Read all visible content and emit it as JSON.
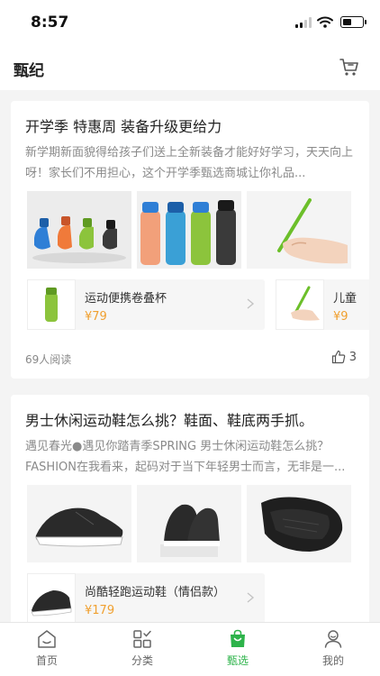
{
  "status_bar": {
    "time": "8:57"
  },
  "header": {
    "title": "甄纪",
    "cart_icon": "cart-icon"
  },
  "articles": [
    {
      "title": "开学季 特惠周 装备升级更给力",
      "summary": "新学期新面貌得给孩子们送上全新装备才能好好学习，天天向上呀！家长们不用担心，这个开学季甄选商城让你礼品...",
      "images": [
        "folding-bottles-image",
        "colored-bottles-image",
        "green-pencil-image"
      ],
      "products": [
        {
          "name": "运动便携卷叠杯",
          "price": "¥79"
        },
        {
          "name": "儿童",
          "price": "¥9"
        }
      ],
      "read_count": "69人阅读",
      "likes": "3"
    },
    {
      "title": "男士休闲运动鞋怎么挑？鞋面、鞋底两手抓。",
      "summary": "遇见春光●遇见你踏青季SPRING 男士休闲运动鞋怎么挑？FASHION在我看来，起码对于当下年轻男士而言，无非是一...",
      "images": [
        "sneaker-side-image",
        "sneaker-front-image",
        "sneaker-sole-image"
      ],
      "products": [
        {
          "name": "尚酷轻跑运动鞋（情侣款）",
          "price": "¥179"
        }
      ]
    }
  ],
  "tabs": [
    {
      "label": "首页",
      "icon": "home-icon"
    },
    {
      "label": "分类",
      "icon": "category-icon"
    },
    {
      "label": "甄选",
      "icon": "shopping-bag-icon"
    },
    {
      "label": "我的",
      "icon": "profile-icon"
    }
  ],
  "colors": {
    "accent": "#2db34a",
    "price": "#f0a030"
  }
}
